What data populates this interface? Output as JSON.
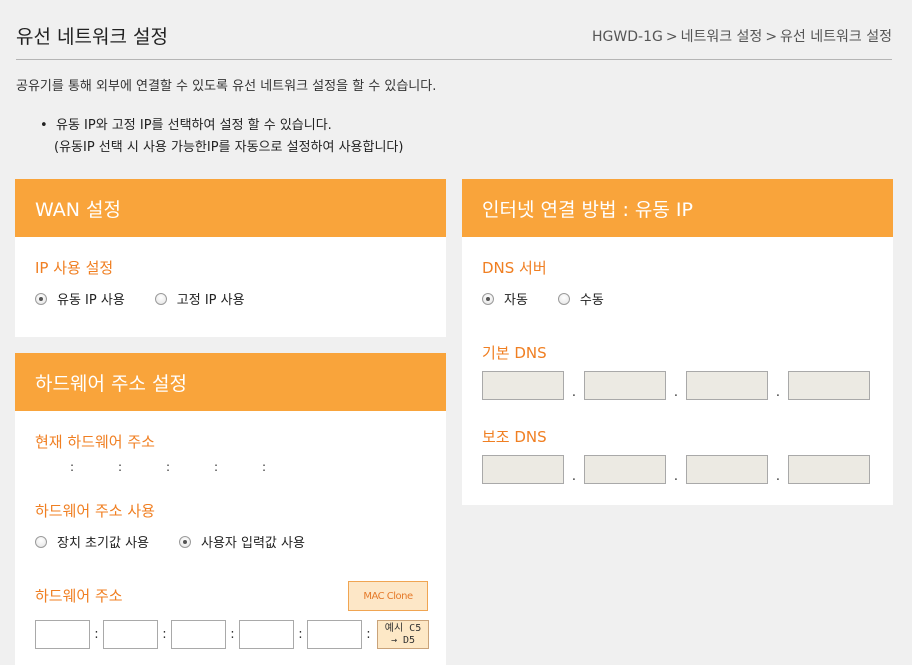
{
  "page": {
    "title": "유선 네트워크 설정",
    "breadcrumb": [
      "HGWD-1G",
      "네트워크 설정",
      "유선 네트워크 설정"
    ],
    "breadcrumb_sep": ">",
    "intro": "공유기를 통해 외부에 연결할 수 있도록 유선 네트워크 설정을 할 수 있습니다.",
    "bullet": "•",
    "notes": [
      "유동 IP와 고정 IP를 선택하여 설정 할 수 있습니다.",
      "(유동IP 선택 시 사용 가능한IP를 자동으로 설정하여 사용합니다)"
    ]
  },
  "wan": {
    "header": "WAN 설정",
    "ip_label": "IP 사용 설정",
    "options": [
      {
        "label": "유동 IP 사용",
        "checked": true
      },
      {
        "label": "고정 IP 사용",
        "checked": false
      }
    ]
  },
  "hw": {
    "header": "하드웨어 주소 설정",
    "current_label": "현재 하드웨어 주소",
    "current_sep": ":",
    "use_label": "하드웨어 주소 사용",
    "options": [
      {
        "label": "장치 초기값 사용",
        "checked": false
      },
      {
        "label": "사용자 입력값 사용",
        "checked": true
      }
    ],
    "addr_label": "하드웨어 주소",
    "clone_button": "MAC Clone",
    "colon": ":",
    "example_line1": "예시 C5",
    "example_line2": "→ D5"
  },
  "internet": {
    "header": "인터넷 연결 방법 : 유동 IP",
    "dns_label": "DNS 서버",
    "dns_options": [
      {
        "label": "자동",
        "checked": true
      },
      {
        "label": "수동",
        "checked": false
      }
    ],
    "primary_label": "기본 DNS",
    "secondary_label": "보조 DNS",
    "dot": "."
  },
  "colors": {
    "accent": "#f9a43b",
    "label": "#f07f22",
    "background": "#f0f0f0"
  }
}
